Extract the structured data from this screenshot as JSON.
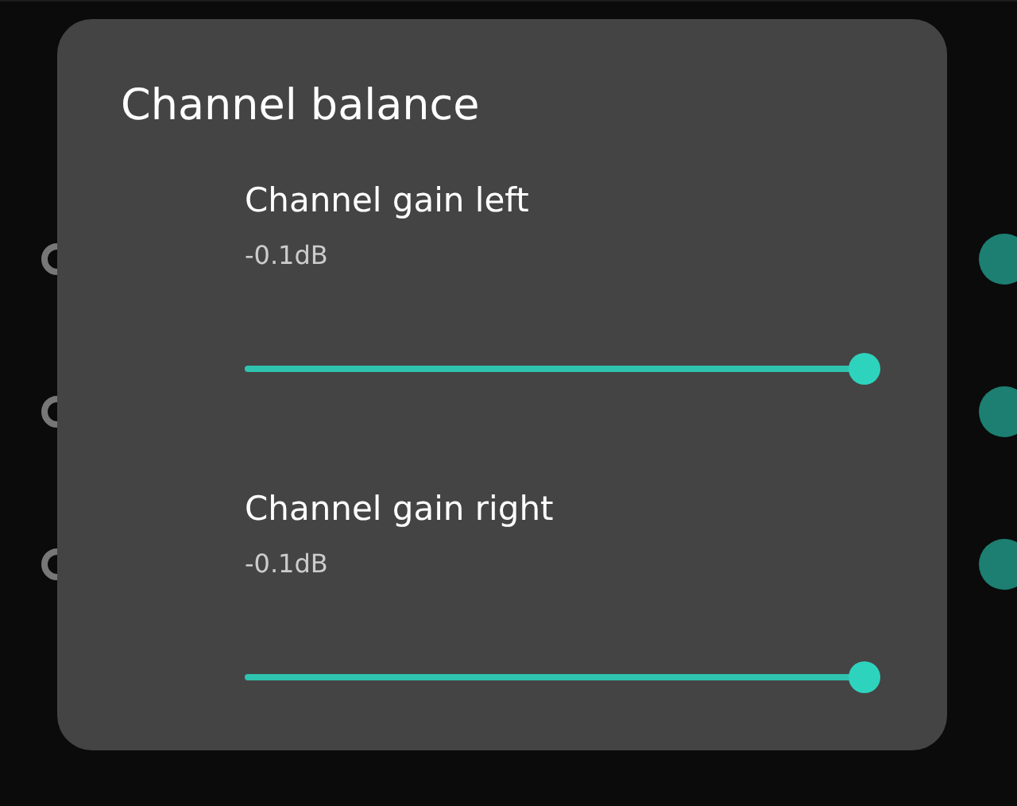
{
  "background_rows": [
    {
      "on": true
    },
    {
      "on": true
    },
    {
      "on": true
    }
  ],
  "dialog": {
    "title": "Channel balance",
    "sliders": [
      {
        "label": "Channel gain left",
        "reading": "-0.1dB",
        "level": 1.0
      },
      {
        "label": "Channel gain right",
        "reading": "-0.1dB",
        "level": 1.0
      }
    ]
  }
}
